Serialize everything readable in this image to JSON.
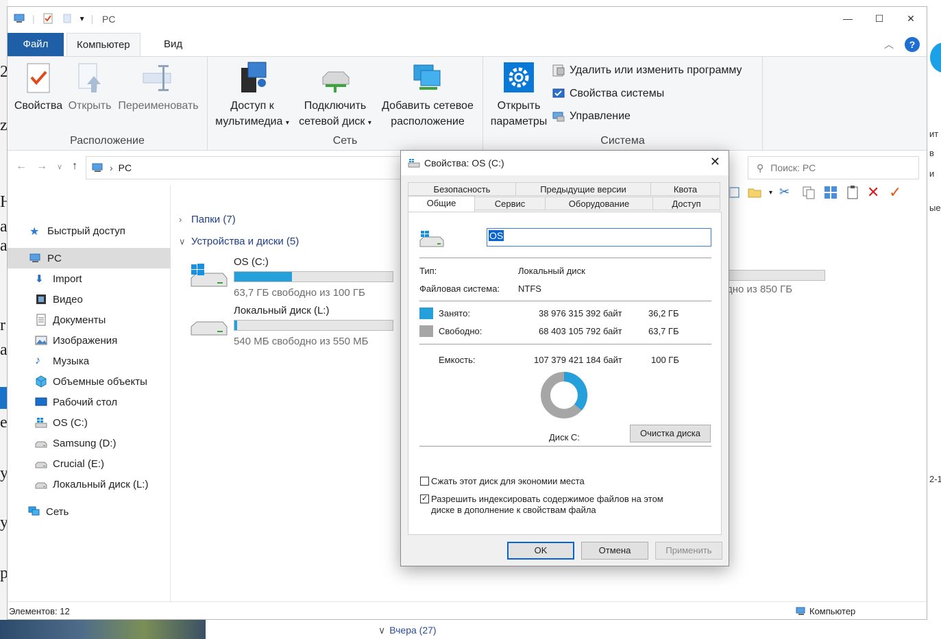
{
  "window": {
    "title": "PC",
    "tabs": {
      "file": "Файл",
      "computer": "Компьютер",
      "view": "Вид"
    },
    "ribbon": {
      "location": {
        "label": "Расположение",
        "properties": "Свойства",
        "open": "Открыть",
        "rename": "Переименовать"
      },
      "network": {
        "label": "Сеть",
        "media_line1": "Доступ к",
        "media_line2": "мультимедиа",
        "map_line1": "Подключить",
        "map_line2": "сетевой диск",
        "add_line1": "Добавить сетевое",
        "add_line2": "расположение"
      },
      "system": {
        "label": "Система",
        "settings_line1": "Открыть",
        "settings_line2": "параметры",
        "uninstall": "Удалить или изменить программу",
        "sysprops": "Свойства системы",
        "manage": "Управление"
      }
    },
    "address": {
      "path": "PC",
      "search_placeholder": "Поиск: PC"
    },
    "sidebar": [
      {
        "label": "Быстрый доступ",
        "icon": "star-icon"
      },
      {
        "label": "PC",
        "icon": "pc-icon",
        "selected": true
      },
      {
        "label": "Import",
        "icon": "download-icon"
      },
      {
        "label": "Видео",
        "icon": "video-icon"
      },
      {
        "label": "Документы",
        "icon": "document-icon"
      },
      {
        "label": "Изображения",
        "icon": "image-icon"
      },
      {
        "label": "Музыка",
        "icon": "music-icon"
      },
      {
        "label": "Объемные объекты",
        "icon": "cube-icon"
      },
      {
        "label": "Рабочий стол",
        "icon": "desktop-icon"
      },
      {
        "label": "OS (C:)",
        "icon": "windows-drive-icon"
      },
      {
        "label": "Samsung (D:)",
        "icon": "drive-icon"
      },
      {
        "label": "Crucial (E:)",
        "icon": "drive-icon"
      },
      {
        "label": "Локальный диск (L:)",
        "icon": "drive-icon"
      },
      {
        "label": "Сеть",
        "icon": "network-icon"
      }
    ],
    "content": {
      "folders": "Папки (7)",
      "devices": "Устройства и диски (5)",
      "drives": [
        {
          "name": "OS (C:)",
          "free": "63,7 ГБ свободно из 100 ГБ",
          "used_fraction": 0.362
        },
        {
          "name": "Локальный диск (L:)",
          "free": "540 МБ свободно из 550 МБ",
          "used_fraction": 0.018
        }
      ],
      "partial_free": "дно из 850 ГБ"
    },
    "status": {
      "items": "Элементов: 12",
      "computer": "Компьютер"
    }
  },
  "dialog": {
    "title": "Свойства: OS (C:)",
    "tabs_row1": [
      "Безопасность",
      "Предыдущие версии",
      "Квота"
    ],
    "tabs_row2": [
      "Общие",
      "Сервис",
      "Оборудование",
      "Доступ"
    ],
    "name_value": "OS",
    "type_label": "Тип:",
    "type_value": "Локальный диск",
    "fs_label": "Файловая система:",
    "fs_value": "NTFS",
    "used_label": "Занято:",
    "used_bytes": "38 976 315 392 байт",
    "used_gb": "36,2 ГБ",
    "free_label": "Свободно:",
    "free_bytes": "68 403 105 792 байт",
    "free_gb": "63,7 ГБ",
    "capacity_label": "Емкость:",
    "capacity_bytes": "107 379 421 184 байт",
    "capacity_gb": "100 ГБ",
    "disk_label": "Диск C:",
    "cleanup": "Очистка диска",
    "compress": "Сжать этот диск для экономии места",
    "index_line1": "Разрешить индексировать содержимое файлов на этом",
    "index_line2": "диске в дополнение к свойствам файла",
    "compress_checked": false,
    "index_checked": true,
    "ok": "OK",
    "cancel": "Отмена",
    "apply": "Применить",
    "used_fraction": 0.363,
    "colors": {
      "used": "#26a0da",
      "free": "#a6a6a6"
    }
  },
  "background": {
    "yesterday": "Вчера (27)"
  }
}
